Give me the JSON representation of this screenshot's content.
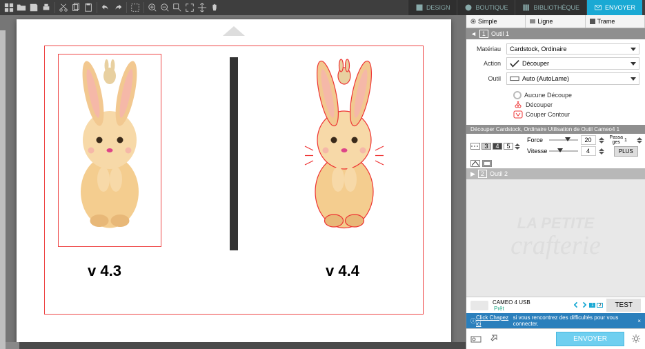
{
  "top_tabs": {
    "design": "DESIGN",
    "boutique": "BOUTIQUE",
    "bibliotheque": "BIBLIOTHÈQUE",
    "envoyer": "ENVOYER"
  },
  "modes": {
    "simple": "Simple",
    "ligne": "Ligne",
    "trame": "Trame"
  },
  "tool1": {
    "header": "Outil 1",
    "materiau_label": "Matériau",
    "materiau_value": "Cardstock, Ordinaire",
    "action_label": "Action",
    "action_value": "Découper",
    "outil_label": "Outil",
    "outil_value": "Auto (AutoLame)",
    "opt_none": "Aucune Découpe",
    "opt_cut": "Découper",
    "opt_contour": "Couper Contour"
  },
  "info_bar": "Découper Cardstock, Ordinaire Utilisation de Outil Cameo4 1",
  "sliders": {
    "force_label": "Force",
    "force_val": "20",
    "vitesse_label": "Vitesse",
    "vitesse_val": "4",
    "passages_label": "Passa\nges",
    "passages_val": "1",
    "plus": "PLUS"
  },
  "dash_vals": [
    "3",
    "4",
    "5"
  ],
  "tool2_header": "Outil 2",
  "watermark": {
    "line1": "LA PETITE",
    "line2": "crafterie"
  },
  "device": {
    "name": "CAMEO 4 USB",
    "status": "Prêt"
  },
  "test_btn": "TEST",
  "help_bar": {
    "link": "Click Chapez ici",
    "text": " si vous rencontrez des difficultés pour vous connecter."
  },
  "send_btn": "ENVOYER",
  "canvas": {
    "v1": "v 4.3",
    "v2": "v 4.4"
  }
}
